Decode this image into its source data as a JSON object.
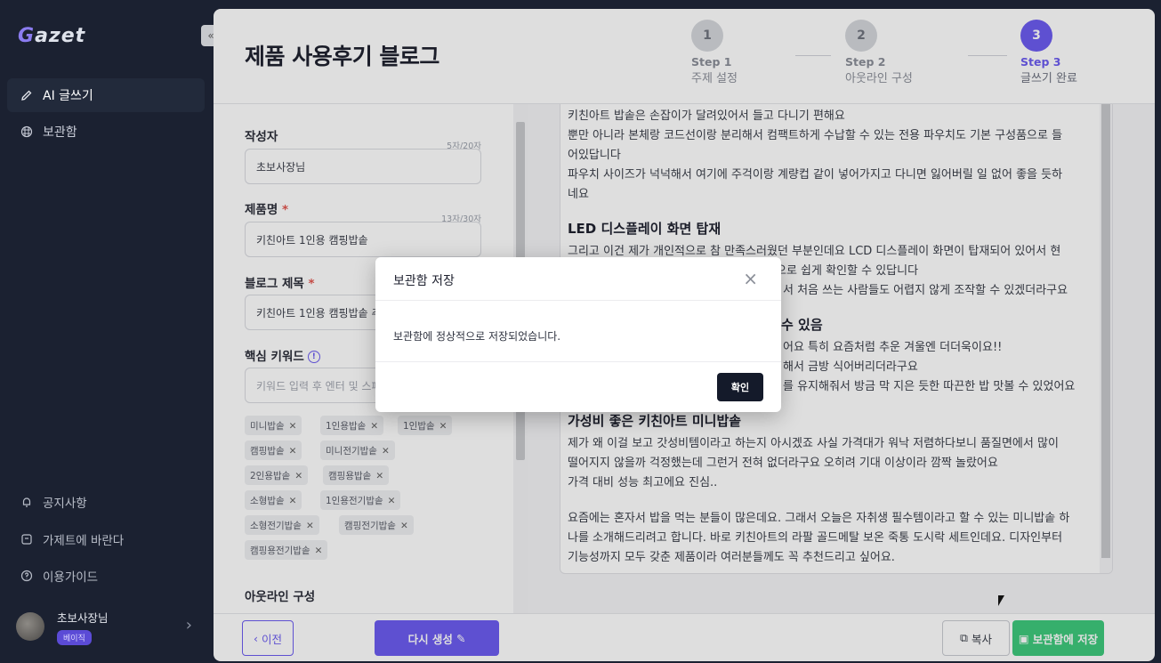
{
  "app": {
    "logo_g": "G",
    "logo_rest": "azet"
  },
  "sidebar": {
    "items": [
      {
        "label": "AI 글쓰기",
        "icon": "pencil-icon"
      },
      {
        "label": "보관함",
        "icon": "archive-icon"
      }
    ],
    "bottom": [
      {
        "label": "공지사항",
        "icon": "bell-icon"
      },
      {
        "label": "가제트에 바란다",
        "icon": "feedback-icon"
      },
      {
        "label": "이용가이드",
        "icon": "help-icon"
      }
    ],
    "user": {
      "name": "초보사장님",
      "badge": "베이직"
    },
    "collapse_glyph": "«"
  },
  "header": {
    "title": "제품 사용후기 블로그"
  },
  "steps": [
    {
      "num": "1",
      "label": "Step 1",
      "desc": "주제 설정"
    },
    {
      "num": "2",
      "label": "Step 2",
      "desc": "아웃라인 구성"
    },
    {
      "num": "3",
      "label": "Step 3",
      "desc": "글쓰기 완료"
    }
  ],
  "form": {
    "author": {
      "label": "작성자",
      "count": "5자/20자",
      "value": "초보사장님"
    },
    "product": {
      "label": "제품명",
      "req": "*",
      "count": "13자/30자",
      "value": "키친아트 1인용 캠핑밥솥"
    },
    "blog_title": {
      "label": "블로그 제목",
      "req": "*",
      "value": "키친아트 1인용 캠핑밥솥 추"
    },
    "keywords": {
      "label": "핵심 키워드",
      "info": "!",
      "placeholder": "키워드 입력 후 엔터 및 스페",
      "chips": [
        "미니밥솥",
        "1인용밥솥",
        "1인밥솥",
        "캠핑밥솥",
        "미니전기밥솥",
        "2인용밥솥",
        "캠핑용밥솥",
        "소형밥솥",
        "1인용전기밥솥",
        "소형전기밥솥",
        "캠핑전기밥솥",
        "캠핑용전기밥솥"
      ]
    },
    "outline": {
      "label": "아웃라인 구성"
    }
  },
  "editor": {
    "lines": [
      "키친아트 밥솥은 손잡이가 달려있어서 들고 다니기 편해요",
      "뿐만 아니라 본체랑 코드선이랑 분리해서 컴팩트하게 수납할 수 있는 전용 파우치도 기본 구성품으로 들",
      "어있답니다",
      "파우치 사이즈가 넉넉해서 여기에 주걱이랑 계량컵 같이 넣어가지고 다니면 잃어버릴 일 없어 좋을 듯하",
      "네요"
    ],
    "h_led": "LED 디스플레이 화면 탑재",
    "led_lines": [
      "그리고 이건 제가 개인적으로 참 만족스러웠던 부분인데요 LCD 디스플레이 화면이 탑재되어 있어서 현",
      "으로 쉽게 확인할 수 있답니다",
      "서 처음 쓰는 사람들도 어렵지 않게 조작할 수 있겠더라구요"
    ],
    "h_partial": "수 있음",
    "mid_lines": [
      "어요 특히 요즘처럼 추운 겨울엔 더더욱이요!!",
      "해서 금방 식어버리더라구요",
      "를 유지해줘서 방금 막 지은 듯한 따끈한 밥 맛볼 수 있었어요"
    ],
    "h_value": "가성비 좋은 키친아트 미니밥솥",
    "value_lines": [
      "제가 왜 이걸 보고 갓성비템이라고 하는지 아시겠죠 사실 가격대가 워낙 저렴하다보니 품질면에서 많이",
      "떨어지지 않을까 걱정했는데 그런거 전혀 없더라구요 오히려 기대 이상이라 깜짝 놀랐어요",
      "가격 대비 성능 최고에요 진심.."
    ],
    "outro_lines": [
      "요즘에는 혼자서 밥을 먹는 분들이 많은데요. 그래서 오늘은 자취생 필수템이라고 할 수 있는 미니밥솥 하",
      "나를 소개해드리려고 합니다. 바로 키친아트의 라팔 골드메탈 보온 죽통 도시락 세트인데요. 디자인부터",
      "기능성까지 모두 갖춘 제품이라 여러분들께도 꼭 추천드리고 싶어요."
    ]
  },
  "footer": {
    "prev": "이전",
    "prev_glyph": "‹",
    "regen": "다시 생성",
    "regen_glyph": "✎",
    "copy": "복사",
    "copy_glyph": "⧉",
    "save": "보관함에 저장",
    "save_glyph": "▣"
  },
  "modal": {
    "title": "보관함 저장",
    "close": "×",
    "body": "보관함에 정상적으로 저장되었습니다.",
    "ok": "확인"
  }
}
